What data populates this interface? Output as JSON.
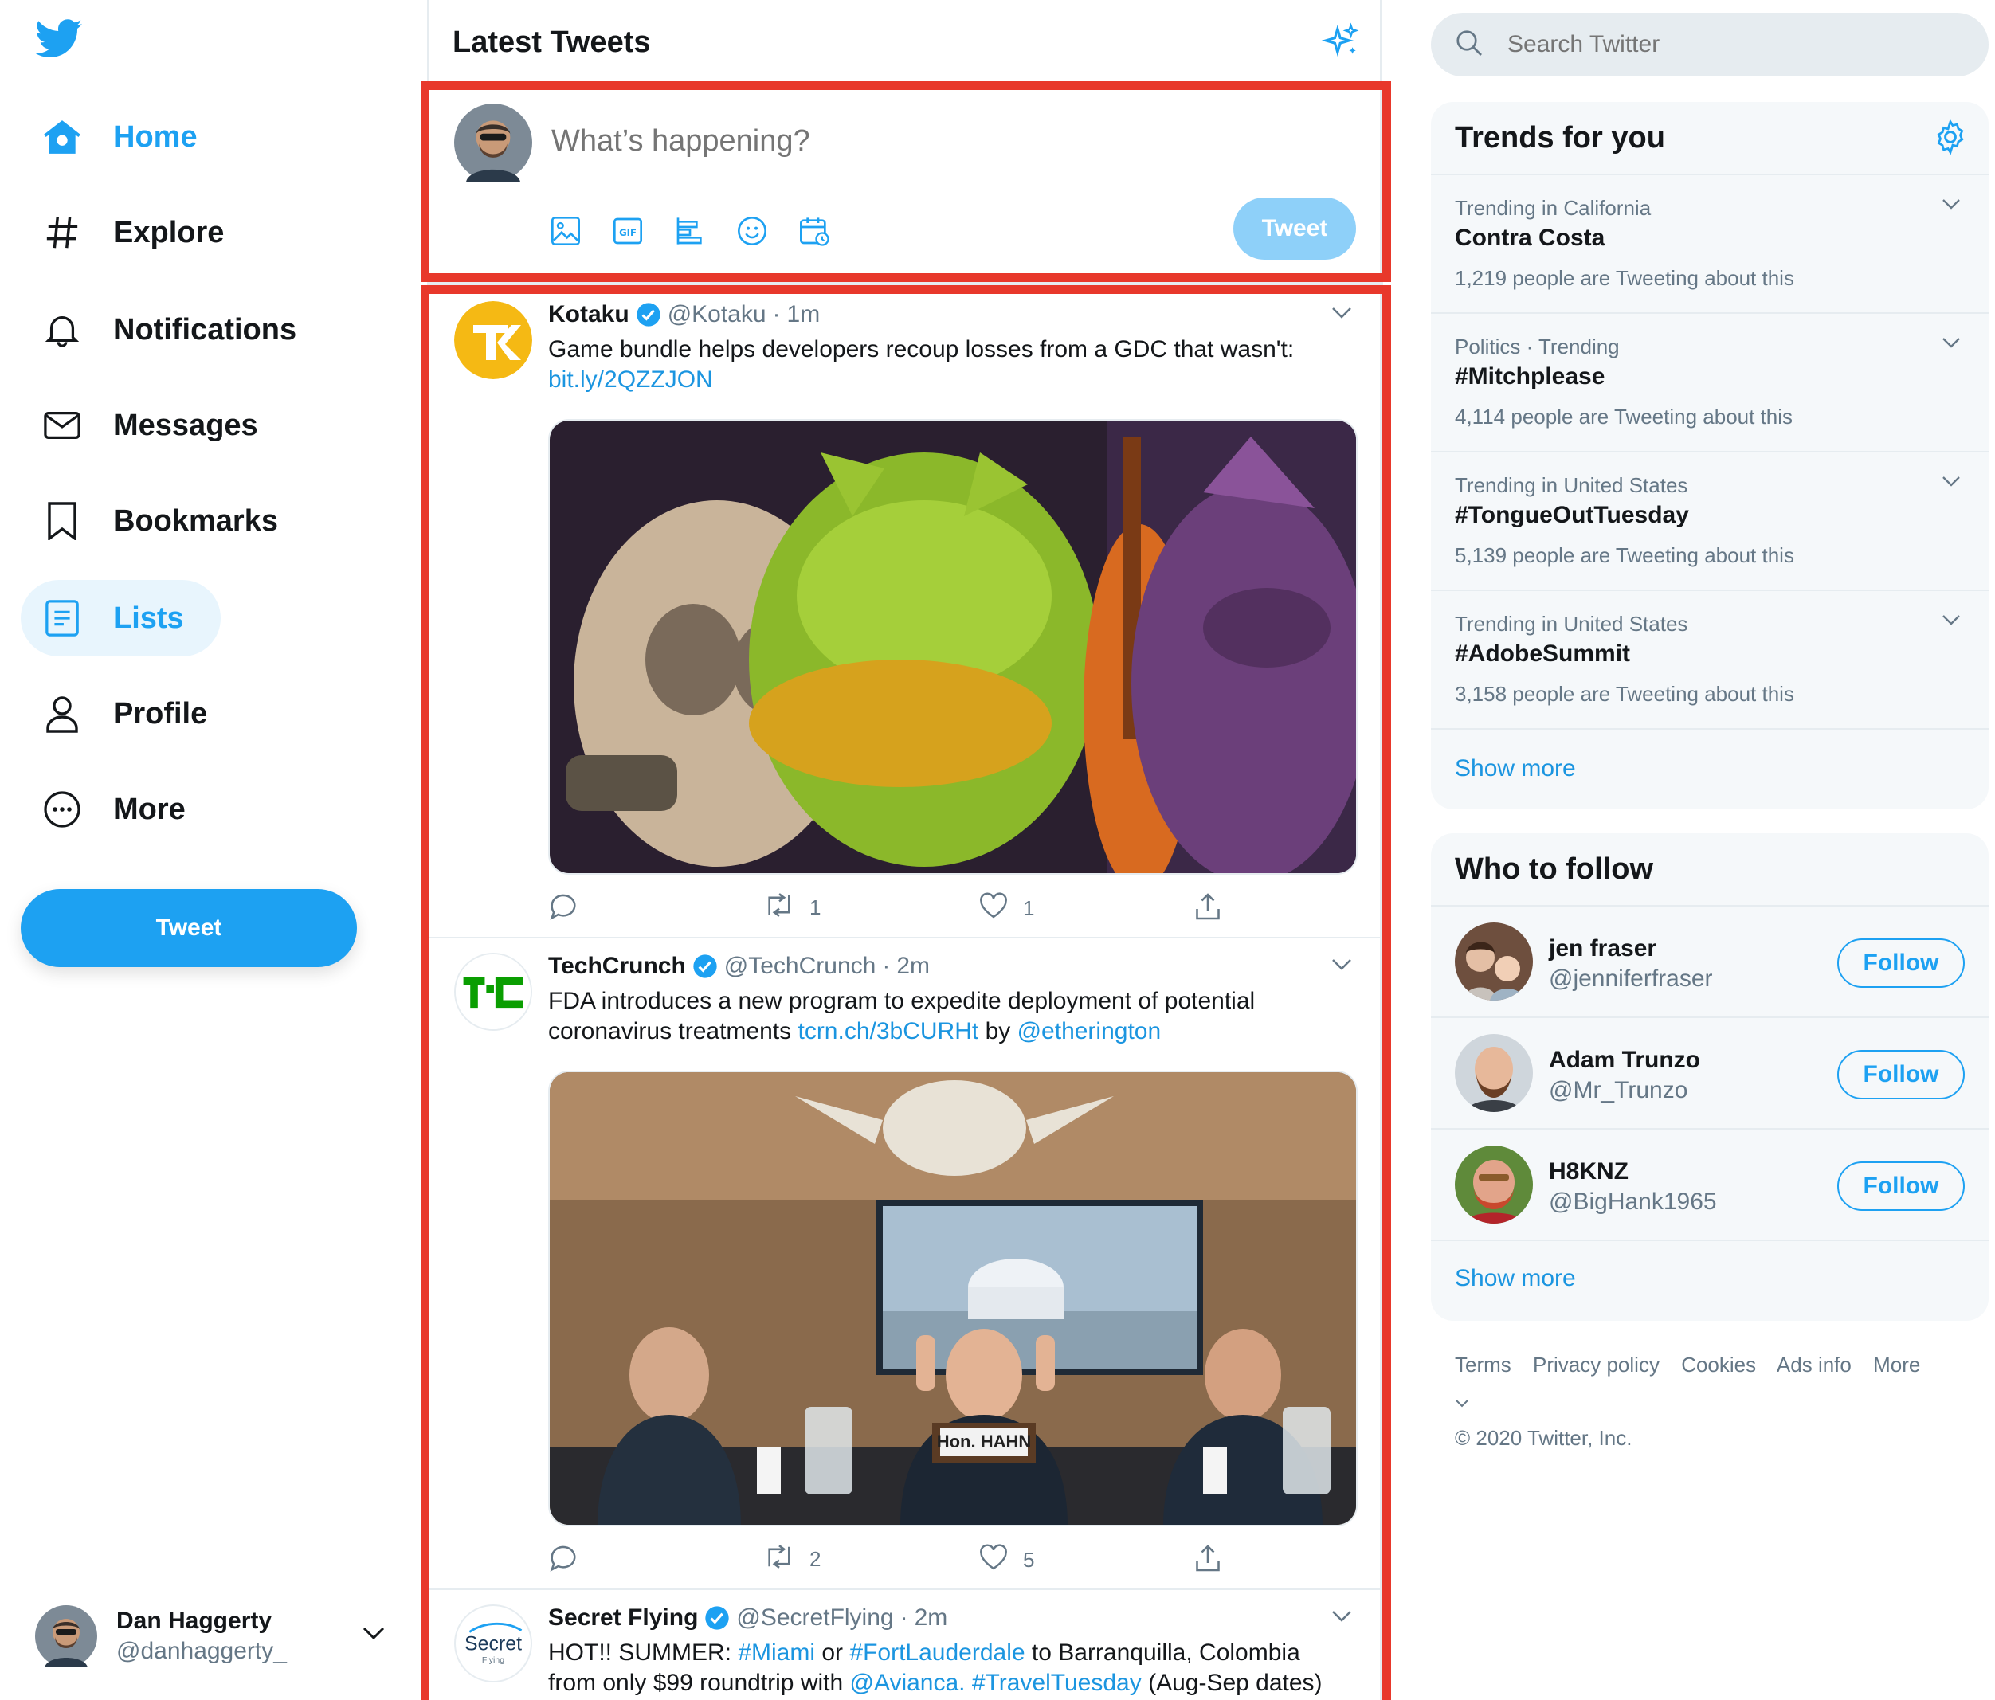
{
  "colors": {
    "accent": "#1da1f2",
    "highlight_border": "#e8382b",
    "link": "#1b95e0"
  },
  "nav": {
    "items": [
      {
        "label": "Home",
        "icon": "home-icon"
      },
      {
        "label": "Explore",
        "icon": "hashtag-icon"
      },
      {
        "label": "Notifications",
        "icon": "bell-icon"
      },
      {
        "label": "Messages",
        "icon": "envelope-icon"
      },
      {
        "label": "Bookmarks",
        "icon": "bookmark-icon"
      },
      {
        "label": "Lists",
        "icon": "list-icon"
      },
      {
        "label": "Profile",
        "icon": "person-icon"
      },
      {
        "label": "More",
        "icon": "more-circle-icon"
      }
    ],
    "tweet_button": "Tweet"
  },
  "account": {
    "display_name": "Dan Haggerty",
    "username": "@danhaggerty_"
  },
  "timeline": {
    "title": "Latest Tweets"
  },
  "composer": {
    "placeholder": "What’s happening?",
    "tweet_label": "Tweet"
  },
  "tweets": [
    {
      "name": "Kotaku",
      "handle": "@Kotaku",
      "sep": "·",
      "time": "1m",
      "text": "Game bundle helps developers recoup losses from a GDC that wasn't:",
      "link": "bit.ly/2QZZJON",
      "retweets": "1",
      "likes": "1"
    },
    {
      "name": "TechCrunch",
      "handle": "@TechCrunch",
      "sep": "·",
      "time": "2m",
      "text": "FDA introduces a new program to expedite deployment of potential coronavirus treatments",
      "link": "tcrn.ch/3bCURHt",
      "by": "by",
      "mention": "@etherington",
      "sign_text": "Hon. HAHN",
      "retweets": "2",
      "likes": "5"
    },
    {
      "name": "Secret Flying",
      "handle": "@SecretFlying",
      "sep": "·",
      "time": "2m",
      "text_a": "HOT!! SUMMER:",
      "tag1": "#Miami",
      "text_b": "or",
      "tag2": "#FortLauderdale",
      "text_c": "to Barranquilla, Colombia",
      "text_d": "from only $99 roundtrip with",
      "mention": "@Avianca",
      "comma": ".",
      "tag3": "#TravelTuesday",
      "text_e": "(Aug-Sep dates)",
      "logo_text": "Secret",
      "logo_sub": "Flying"
    }
  ],
  "search": {
    "placeholder": "Search Twitter"
  },
  "trends": {
    "title": "Trends for you",
    "items": [
      {
        "context": "Trending in California",
        "name": "Contra Costa",
        "count": "1,219 people are Tweeting about this"
      },
      {
        "context": "Politics · Trending",
        "name": "#Mitchplease",
        "count": "4,114 people are Tweeting about this"
      },
      {
        "context": "Trending in United States",
        "name": "#TongueOutTuesday",
        "count": "5,139 people are Tweeting about this"
      },
      {
        "context": "Trending in United States",
        "name": "#AdobeSummit",
        "count": "3,158 people are Tweeting about this"
      }
    ],
    "show_more": "Show more"
  },
  "who_to_follow": {
    "title": "Who to follow",
    "items": [
      {
        "name": "jen fraser",
        "handle": "@jenniferfraser",
        "button": "Follow"
      },
      {
        "name": "Adam Trunzo",
        "handle": "@Mr_Trunzo",
        "button": "Follow"
      },
      {
        "name": "H8KNZ",
        "handle": "@BigHank1965",
        "button": "Follow"
      }
    ],
    "show_more": "Show more"
  },
  "footer": {
    "links": [
      "Terms",
      "Privacy policy",
      "Cookies",
      "Ads info",
      "More"
    ],
    "copyright": "© 2020 Twitter, Inc."
  }
}
